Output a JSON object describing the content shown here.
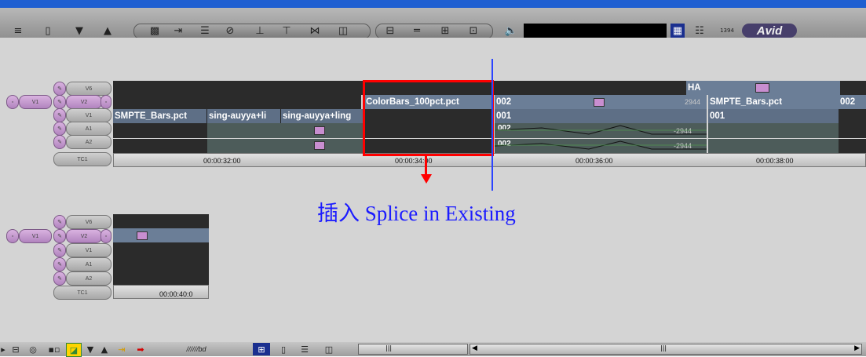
{
  "toolbar": {
    "buttons": [
      "align-icon",
      "clip-icon",
      "triangle-down-icon",
      "triangle-up-icon",
      "frame-icon",
      "export-icon",
      "stack-icon",
      "no-icon",
      "crop-icon",
      "keyframe-icon",
      "bowtie-icon",
      "split-icon",
      "minus-icon",
      "layout-icon",
      "sync-icon",
      "mark-icon",
      "speaker-icon",
      "grid-icon",
      "list-icon",
      "counter-icon"
    ],
    "brand": "Avid"
  },
  "timeline_top": {
    "track_labels": [
      "V6",
      "V2",
      "V1",
      "A1",
      "A2",
      "TC1"
    ],
    "source_label": "V1",
    "v6_clip": "HA",
    "v2_clips": [
      "ColorBars_100pct.pct",
      "002",
      "SMPTE_Bars.pct",
      "002"
    ],
    "v2_frame_number": "2944",
    "v1_clips": [
      "SMPTE_Bars.pct",
      "sing-auyya+li",
      "sing-auyya+ling",
      "001",
      "001"
    ],
    "audio_values": [
      "-2944",
      "-2944"
    ],
    "audio_markers": [
      "002",
      "002"
    ],
    "timecodes": [
      "00:00:32:00",
      "00:00:34:00",
      "00:00:36:00",
      "00:00:38:00"
    ]
  },
  "timeline_bottom": {
    "track_labels": [
      "V6",
      "V2",
      "V1",
      "A1",
      "A2",
      "TC1"
    ],
    "source_label": "V1",
    "timecode": "00:00:40:0"
  },
  "annotation": {
    "text": "插入 Splice in Existing"
  },
  "bottom_bar": {
    "label": "//////bd",
    "scroll_marker": "|||"
  },
  "colors": {
    "highlight_box": "#ff0000",
    "insertion_line": "#2b44ff",
    "annotation_text": "#1c1cff",
    "brand_bg": "#473f6b"
  }
}
